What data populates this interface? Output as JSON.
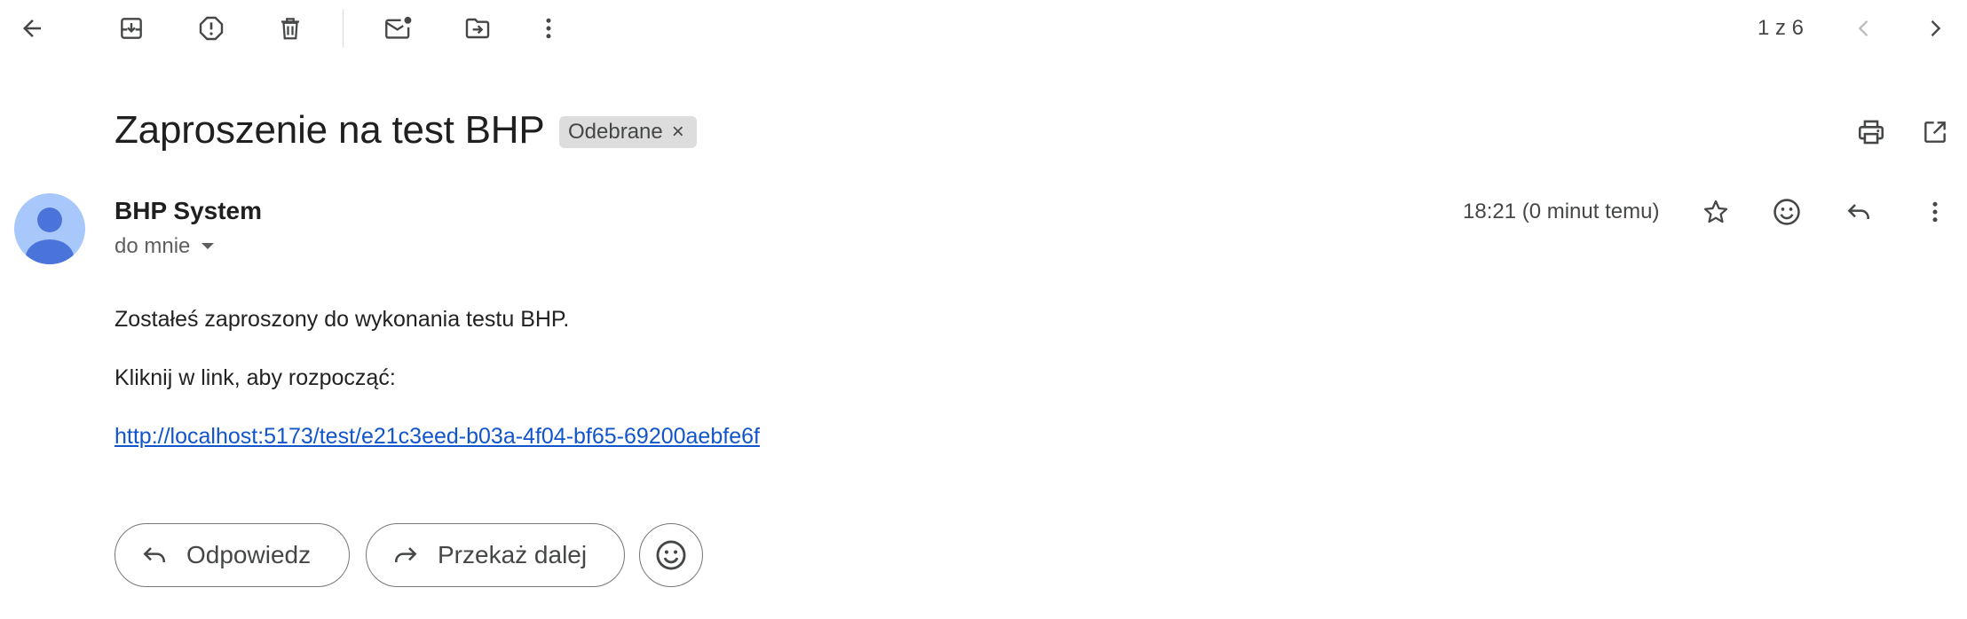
{
  "toolbar": {
    "icons": {
      "back": "arrow-back-icon",
      "archive": "archive-icon",
      "report_spam": "report-spam-icon",
      "delete": "trash-icon",
      "mark_unread": "mark-unread-icon",
      "move_to": "move-to-folder-icon",
      "more": "more-vert-icon"
    },
    "pager_text": "1 z 6",
    "older_icon": "chevron-left-icon",
    "newer_icon": "chevron-right-icon"
  },
  "message": {
    "subject": "Zaproszenie na test BHP",
    "label": "Odebrane",
    "label_remove": "×",
    "sender_name": "BHP System",
    "recipient": "do mnie",
    "timestamp": "18:21 (0 minut temu)",
    "body": {
      "line1": "Zostałeś zaproszony do wykonania testu BHP.",
      "line2": "Kliknij w link, aby rozpocząć:",
      "link": "http://localhost:5173/test/e21c3eed-b03a-4f04-bf65-69200aebfe6f"
    }
  },
  "actions": {
    "reply_label": "Odpowiedz",
    "forward_label": "Przekaż dalej"
  },
  "colors": {
    "avatar_bg": "#a8c7fa",
    "avatar_fg": "#4a74d9",
    "link": "#1155cc",
    "chip_bg": "#dddddd"
  }
}
